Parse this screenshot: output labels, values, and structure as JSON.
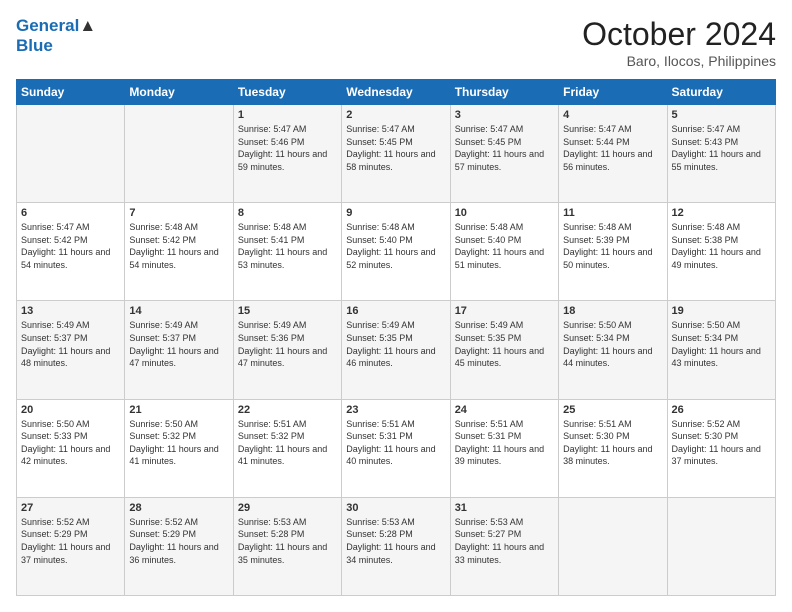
{
  "header": {
    "logo_line1": "General",
    "logo_line2": "Blue",
    "month": "October 2024",
    "location": "Baro, Ilocos, Philippines"
  },
  "weekdays": [
    "Sunday",
    "Monday",
    "Tuesday",
    "Wednesday",
    "Thursday",
    "Friday",
    "Saturday"
  ],
  "rows": [
    [
      {
        "day": "",
        "info": ""
      },
      {
        "day": "",
        "info": ""
      },
      {
        "day": "1",
        "info": "Sunrise: 5:47 AM\nSunset: 5:46 PM\nDaylight: 11 hours and 59 minutes."
      },
      {
        "day": "2",
        "info": "Sunrise: 5:47 AM\nSunset: 5:45 PM\nDaylight: 11 hours and 58 minutes."
      },
      {
        "day": "3",
        "info": "Sunrise: 5:47 AM\nSunset: 5:45 PM\nDaylight: 11 hours and 57 minutes."
      },
      {
        "day": "4",
        "info": "Sunrise: 5:47 AM\nSunset: 5:44 PM\nDaylight: 11 hours and 56 minutes."
      },
      {
        "day": "5",
        "info": "Sunrise: 5:47 AM\nSunset: 5:43 PM\nDaylight: 11 hours and 55 minutes."
      }
    ],
    [
      {
        "day": "6",
        "info": "Sunrise: 5:47 AM\nSunset: 5:42 PM\nDaylight: 11 hours and 54 minutes."
      },
      {
        "day": "7",
        "info": "Sunrise: 5:48 AM\nSunset: 5:42 PM\nDaylight: 11 hours and 54 minutes."
      },
      {
        "day": "8",
        "info": "Sunrise: 5:48 AM\nSunset: 5:41 PM\nDaylight: 11 hours and 53 minutes."
      },
      {
        "day": "9",
        "info": "Sunrise: 5:48 AM\nSunset: 5:40 PM\nDaylight: 11 hours and 52 minutes."
      },
      {
        "day": "10",
        "info": "Sunrise: 5:48 AM\nSunset: 5:40 PM\nDaylight: 11 hours and 51 minutes."
      },
      {
        "day": "11",
        "info": "Sunrise: 5:48 AM\nSunset: 5:39 PM\nDaylight: 11 hours and 50 minutes."
      },
      {
        "day": "12",
        "info": "Sunrise: 5:48 AM\nSunset: 5:38 PM\nDaylight: 11 hours and 49 minutes."
      }
    ],
    [
      {
        "day": "13",
        "info": "Sunrise: 5:49 AM\nSunset: 5:37 PM\nDaylight: 11 hours and 48 minutes."
      },
      {
        "day": "14",
        "info": "Sunrise: 5:49 AM\nSunset: 5:37 PM\nDaylight: 11 hours and 47 minutes."
      },
      {
        "day": "15",
        "info": "Sunrise: 5:49 AM\nSunset: 5:36 PM\nDaylight: 11 hours and 47 minutes."
      },
      {
        "day": "16",
        "info": "Sunrise: 5:49 AM\nSunset: 5:35 PM\nDaylight: 11 hours and 46 minutes."
      },
      {
        "day": "17",
        "info": "Sunrise: 5:49 AM\nSunset: 5:35 PM\nDaylight: 11 hours and 45 minutes."
      },
      {
        "day": "18",
        "info": "Sunrise: 5:50 AM\nSunset: 5:34 PM\nDaylight: 11 hours and 44 minutes."
      },
      {
        "day": "19",
        "info": "Sunrise: 5:50 AM\nSunset: 5:34 PM\nDaylight: 11 hours and 43 minutes."
      }
    ],
    [
      {
        "day": "20",
        "info": "Sunrise: 5:50 AM\nSunset: 5:33 PM\nDaylight: 11 hours and 42 minutes."
      },
      {
        "day": "21",
        "info": "Sunrise: 5:50 AM\nSunset: 5:32 PM\nDaylight: 11 hours and 41 minutes."
      },
      {
        "day": "22",
        "info": "Sunrise: 5:51 AM\nSunset: 5:32 PM\nDaylight: 11 hours and 41 minutes."
      },
      {
        "day": "23",
        "info": "Sunrise: 5:51 AM\nSunset: 5:31 PM\nDaylight: 11 hours and 40 minutes."
      },
      {
        "day": "24",
        "info": "Sunrise: 5:51 AM\nSunset: 5:31 PM\nDaylight: 11 hours and 39 minutes."
      },
      {
        "day": "25",
        "info": "Sunrise: 5:51 AM\nSunset: 5:30 PM\nDaylight: 11 hours and 38 minutes."
      },
      {
        "day": "26",
        "info": "Sunrise: 5:52 AM\nSunset: 5:30 PM\nDaylight: 11 hours and 37 minutes."
      }
    ],
    [
      {
        "day": "27",
        "info": "Sunrise: 5:52 AM\nSunset: 5:29 PM\nDaylight: 11 hours and 37 minutes."
      },
      {
        "day": "28",
        "info": "Sunrise: 5:52 AM\nSunset: 5:29 PM\nDaylight: 11 hours and 36 minutes."
      },
      {
        "day": "29",
        "info": "Sunrise: 5:53 AM\nSunset: 5:28 PM\nDaylight: 11 hours and 35 minutes."
      },
      {
        "day": "30",
        "info": "Sunrise: 5:53 AM\nSunset: 5:28 PM\nDaylight: 11 hours and 34 minutes."
      },
      {
        "day": "31",
        "info": "Sunrise: 5:53 AM\nSunset: 5:27 PM\nDaylight: 11 hours and 33 minutes."
      },
      {
        "day": "",
        "info": ""
      },
      {
        "day": "",
        "info": ""
      }
    ]
  ]
}
